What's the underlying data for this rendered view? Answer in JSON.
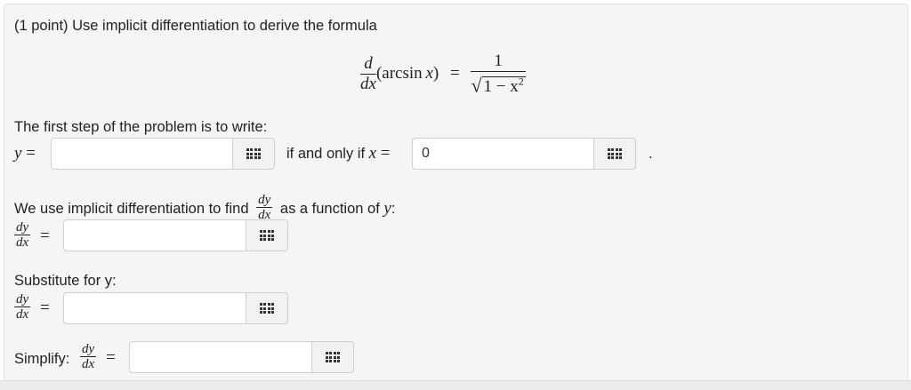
{
  "problem": {
    "intro": "(1 point) Use implicit differentiation to derive the formula",
    "formula": {
      "d": "d",
      "dx": "dx",
      "arcsin": "(arcsin",
      "x": "x",
      "close": ")",
      "equals": "=",
      "one": "1",
      "radicand": "1 − x",
      "exp": "2"
    }
  },
  "step1": {
    "label": "The first step of the problem is to write:",
    "y_var": "y",
    "equals": "=",
    "input1_value": "",
    "iff_text": "if and only if",
    "x_var": "x",
    "input2_value": "0",
    "period": "."
  },
  "step2": {
    "label_before": "We use implicit differentiation to find",
    "frac_num": "dy",
    "frac_den": "dx",
    "label_after": "as a function of",
    "y_var": "y",
    "colon": ":",
    "equals": "=",
    "input_value": ""
  },
  "step3": {
    "label": "Substitute for y:",
    "frac_num": "dy",
    "frac_den": "dx",
    "equals": "=",
    "input_value": ""
  },
  "step4": {
    "label": "Simplify:",
    "frac_num": "dy",
    "frac_den": "dx",
    "equals": "=",
    "input_value": ""
  },
  "icons": {
    "keyboard": "equation-editor-icon"
  }
}
